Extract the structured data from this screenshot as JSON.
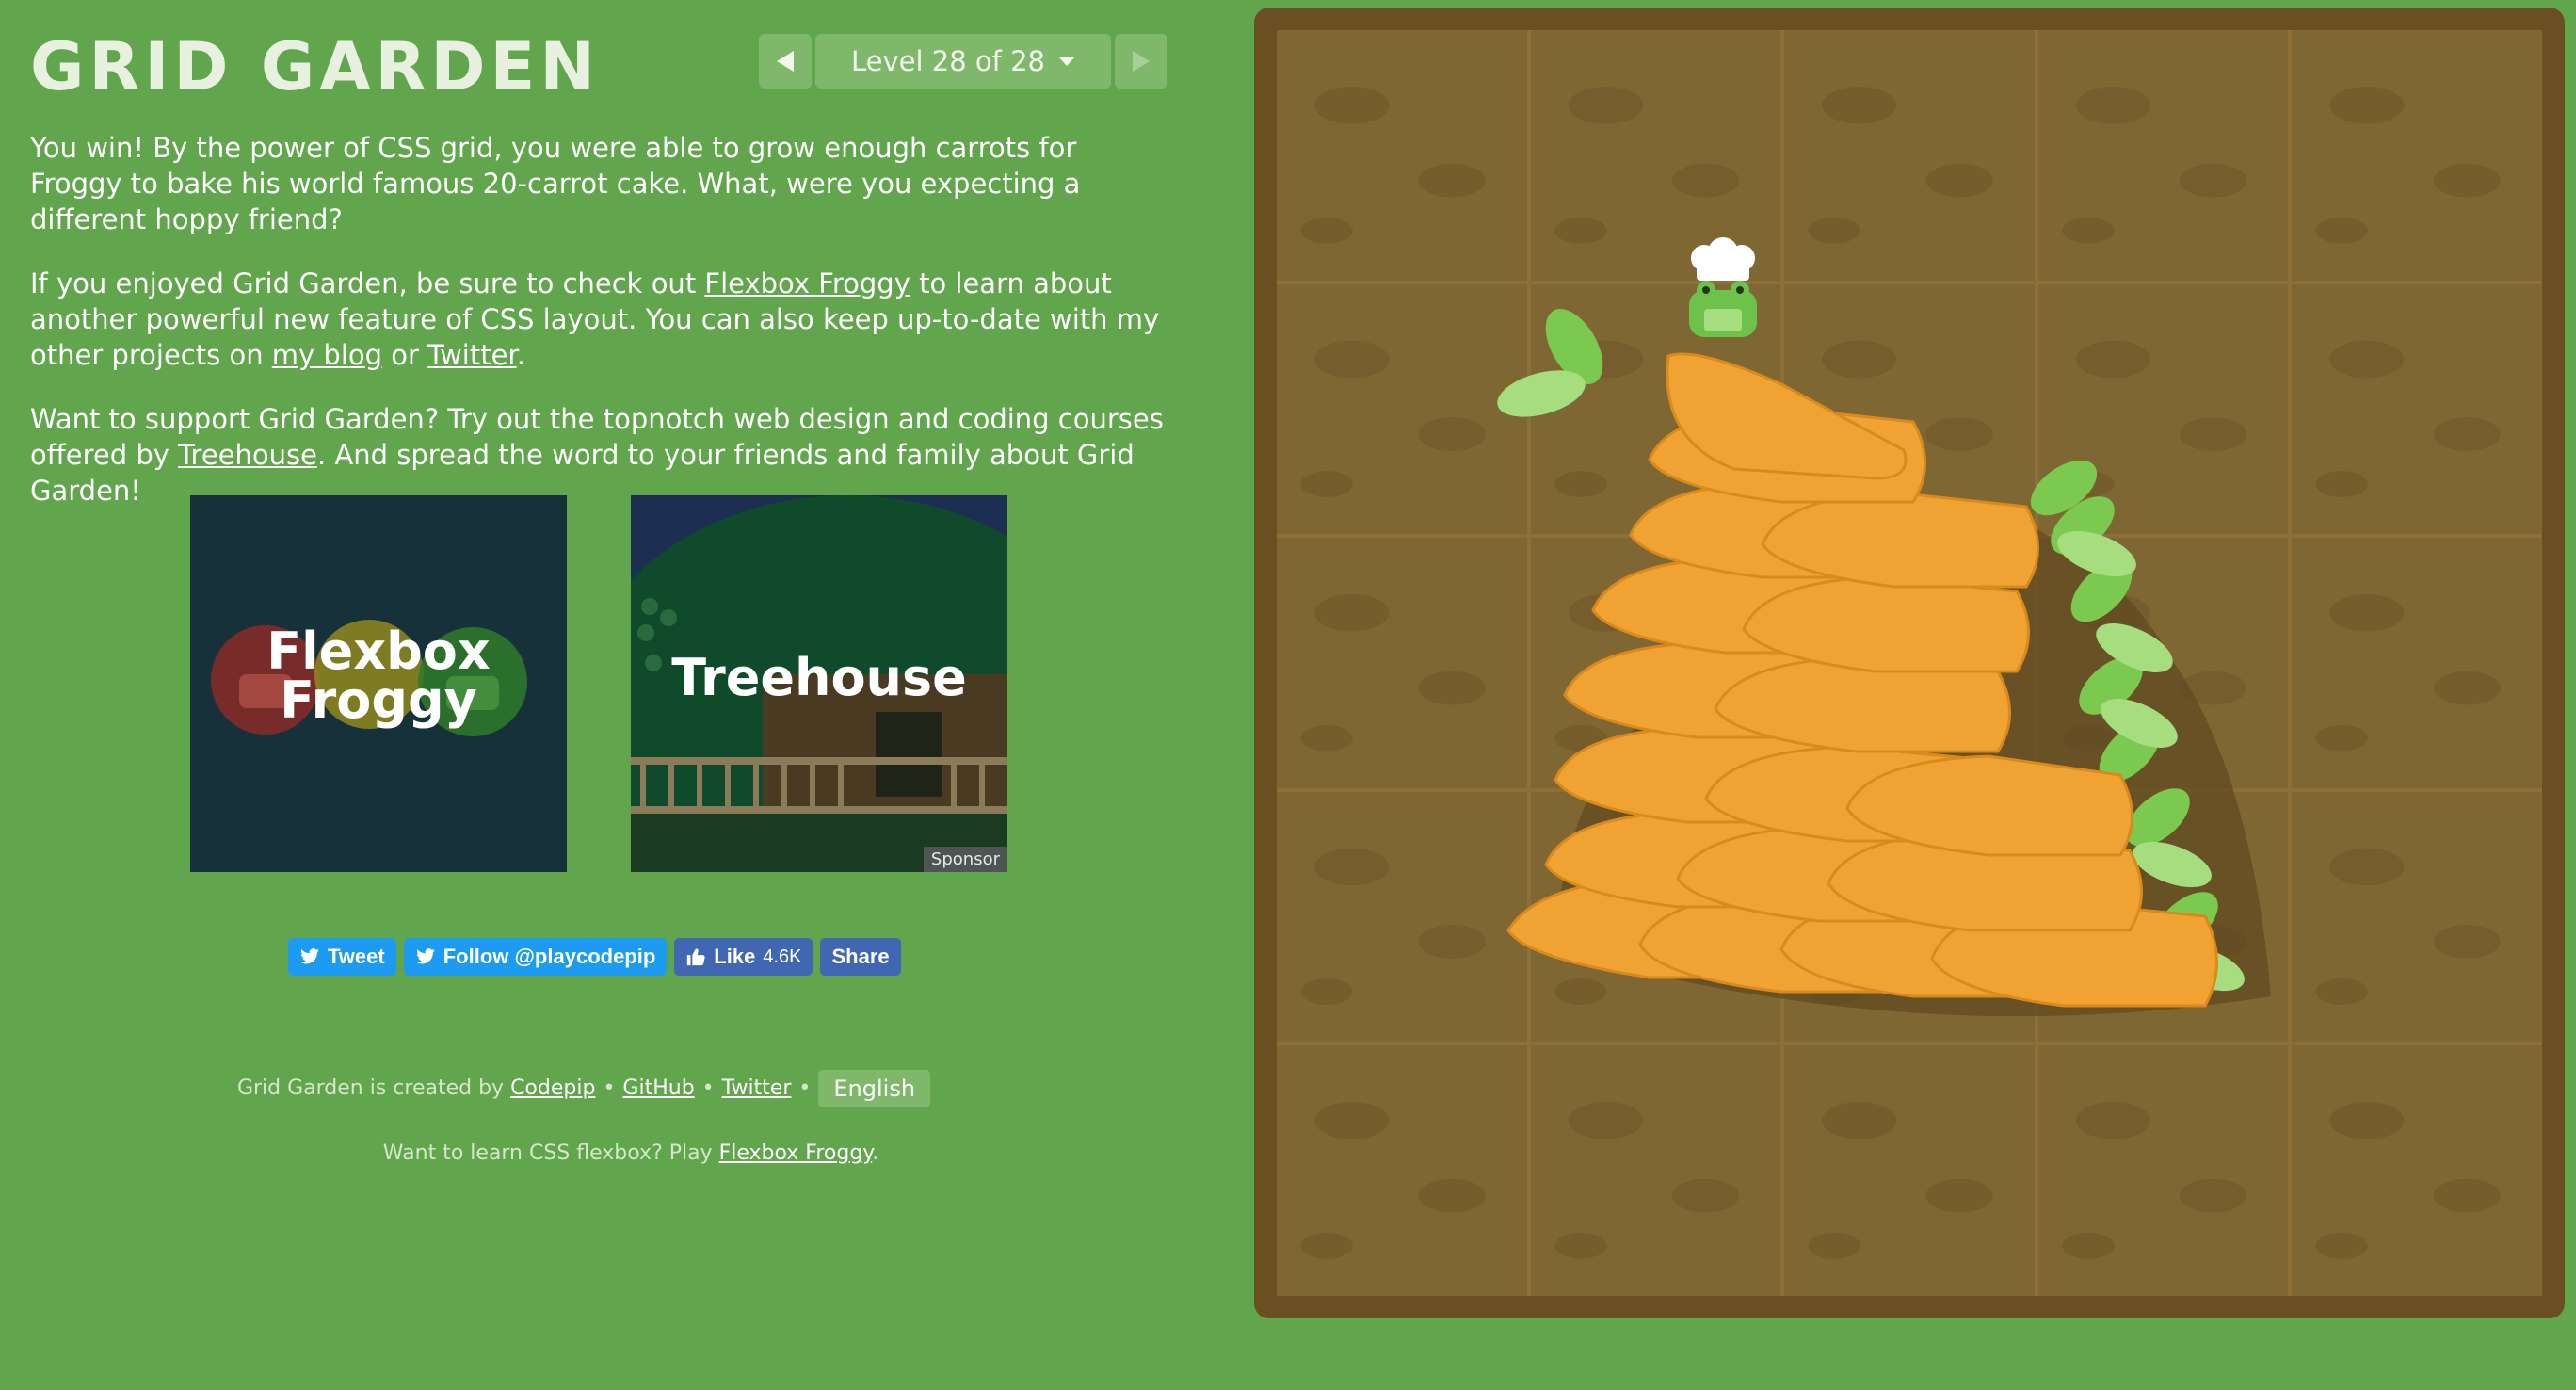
{
  "header": {
    "title": "GRID GARDEN",
    "level_label": "Level 28 of 28"
  },
  "instructions": {
    "p1": "You win! By the power of CSS grid, you were able to grow enough carrots for Froggy to bake his world famous 20-carrot cake. What, were you expecting a different hoppy friend?",
    "p2_before": "If you enjoyed Grid Garden, be sure to check out ",
    "p2_link1": "Flexbox Froggy",
    "p2_mid": " to learn about another powerful new feature of CSS layout. You can also keep up-to-date with my other projects on ",
    "p2_link2": "my blog",
    "p2_or": " or ",
    "p2_link3": "Twitter",
    "p2_end": ".",
    "p3_before": "Want to support Grid Garden? Try out the topnotch web design and coding courses offered by ",
    "p3_link": "Treehouse",
    "p3_end": ". And spread the word to your friends and family about Grid Garden!"
  },
  "promos": {
    "flexbox_line1": "Flexbox",
    "flexbox_line2": "Froggy",
    "treehouse": "Treehouse",
    "sponsor": "Sponsor"
  },
  "social": {
    "tweet": "Tweet",
    "follow": "Follow @playcodepip",
    "like": "Like",
    "like_count": "4.6K",
    "share": "Share"
  },
  "footer": {
    "created_by": "Grid Garden is created by ",
    "codepip": "Codepip",
    "github": "GitHub",
    "twitter": "Twitter",
    "language": "English",
    "flexbox_prompt": "Want to learn CSS flexbox? Play ",
    "flexbox_link": "Flexbox Froggy",
    "flexbox_end": "."
  },
  "colors": {
    "background": "#61a54c",
    "soil": "#7f6734",
    "carrot": "#f0a232",
    "leaf": "#7cc94f"
  }
}
